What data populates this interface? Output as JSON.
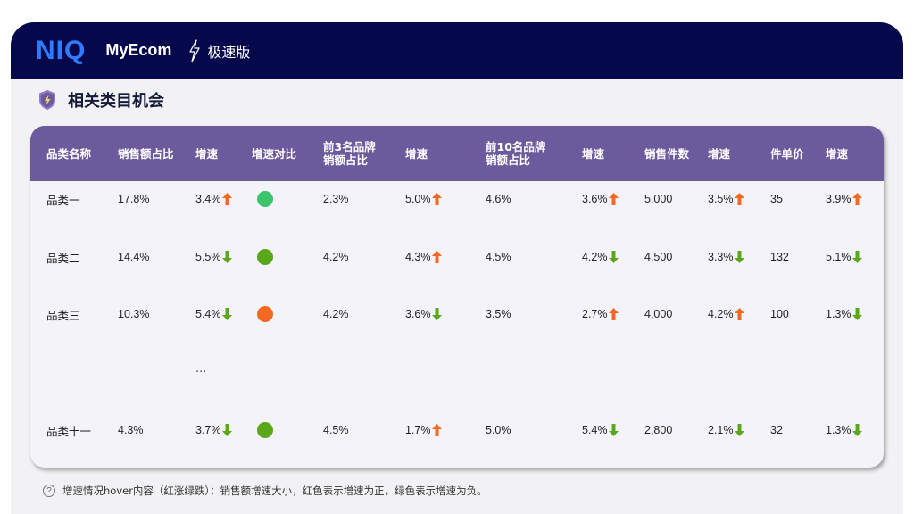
{
  "header": {
    "logo": "NIQ",
    "app_name": "MyEcom",
    "edition": "极速版"
  },
  "section": {
    "title": "相关类目机会"
  },
  "colors": {
    "up": "#f26a21",
    "down": "#5aa81a",
    "dot_green": "#3cc46a",
    "dot_olive": "#5aa81a",
    "dot_orange": "#f26a21"
  },
  "table": {
    "headers": [
      "品类名称",
      "销售额占比",
      "增速",
      "增速对比",
      "前3名品牌\n销额占比",
      "增速",
      "前10名品牌\n销额占比",
      "增速",
      "销售件数",
      "增速",
      "件单价",
      "增速"
    ],
    "rows": [
      {
        "name": "品类一",
        "sales_share": "17.8%",
        "growth": "3.4%",
        "growth_dir": "up",
        "dot": "dot_green",
        "top3_share": "2.3%",
        "top3_growth": "5.0%",
        "top3_dir": "up",
        "top10_share": "4.6%",
        "top10_growth": "3.6%",
        "top10_dir": "up",
        "units": "5,000",
        "units_growth": "3.5%",
        "units_dir": "up",
        "unit_price": "35",
        "price_growth": "3.9%",
        "price_dir": "up"
      },
      {
        "name": "品类二",
        "sales_share": "14.4%",
        "growth": "5.5%",
        "growth_dir": "down",
        "dot": "dot_olive",
        "top3_share": "4.2%",
        "top3_growth": "4.3%",
        "top3_dir": "up",
        "top10_share": "4.5%",
        "top10_growth": "4.2%",
        "top10_dir": "down",
        "units": "4,500",
        "units_growth": "3.3%",
        "units_dir": "down",
        "unit_price": "132",
        "price_growth": "5.1%",
        "price_dir": "down"
      },
      {
        "name": "品类三",
        "sales_share": "10.3%",
        "growth": "5.4%",
        "growth_dir": "down",
        "dot": "dot_orange",
        "top3_share": "4.2%",
        "top3_growth": "3.6%",
        "top3_dir": "down",
        "top10_share": "3.5%",
        "top10_growth": "2.7%",
        "top10_dir": "up",
        "units": "4,000",
        "units_growth": "4.2%",
        "units_dir": "up",
        "unit_price": "100",
        "price_growth": "1.3%",
        "price_dir": "down"
      },
      {
        "name": "品类十一",
        "sales_share": "4.3%",
        "growth": "3.7%",
        "growth_dir": "down",
        "dot": "dot_olive",
        "top3_share": "4.5%",
        "top3_growth": "1.7%",
        "top3_dir": "up",
        "top10_share": "5.0%",
        "top10_growth": "5.4%",
        "top10_dir": "down",
        "units": "2,800",
        "units_growth": "2.1%",
        "units_dir": "down",
        "unit_price": "32",
        "price_growth": "1.3%",
        "price_dir": "down"
      }
    ],
    "ellipsis": "..."
  },
  "footer": {
    "icon": "?",
    "note": "增速情况hover内容（红涨绿跌）：销售额增速大小，红色表示增速为正，绿色表示增速为负。"
  }
}
